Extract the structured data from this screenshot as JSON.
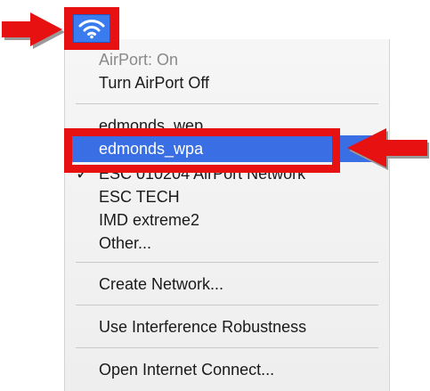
{
  "menu": {
    "items": [
      {
        "label": "AirPort: On",
        "state": "disabled"
      },
      {
        "label": "Turn AirPort Off"
      },
      {
        "label": "edmonds_wep"
      },
      {
        "label": "edmonds_wpa",
        "state": "selected"
      },
      {
        "label": "ESC 010204 AirPort Network",
        "checked": true
      },
      {
        "label": "ESC TECH"
      },
      {
        "label": "IMD extreme2"
      },
      {
        "label": "Other..."
      },
      {
        "label": "Create Network..."
      },
      {
        "label": "Use Interference Robustness"
      },
      {
        "label": "Open Internet Connect..."
      }
    ],
    "check_mark": "✓"
  },
  "icons": {
    "status": "wifi-icon",
    "pointer_left": "red-arrow-icon",
    "pointer_right": "red-arrow-icon"
  },
  "colors": {
    "highlight_red": "#e81111",
    "selection_blue": "#3a6ee5",
    "wifi_tile_blue": "#3a7cf0"
  }
}
